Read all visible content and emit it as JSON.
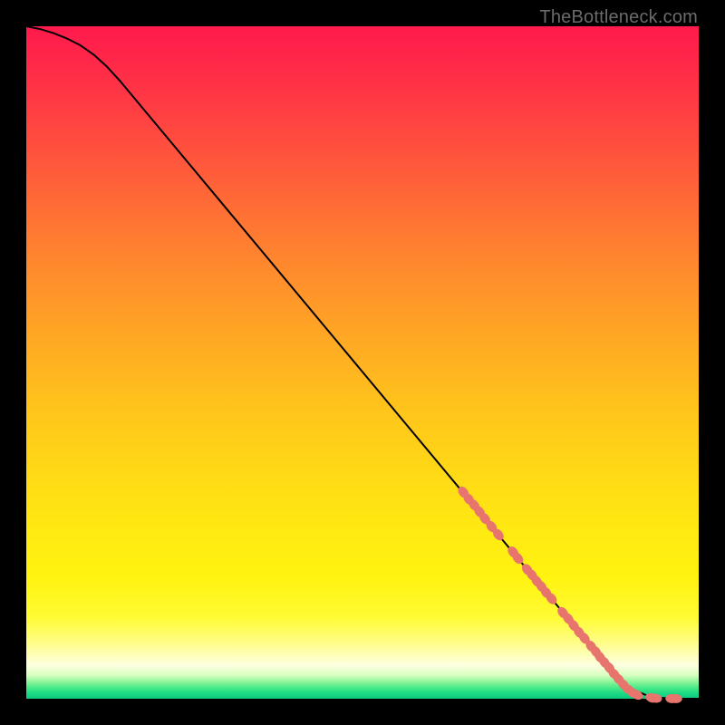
{
  "watermark": "TheBottleneck.com",
  "chart_data": {
    "type": "line",
    "title": "",
    "xlabel": "",
    "ylabel": "",
    "xlim": [
      0,
      100
    ],
    "ylim": [
      0,
      100
    ],
    "grid": false,
    "legend": false,
    "annotations": [],
    "series": [
      {
        "name": "bottleneck-curve",
        "x": [
          0,
          2,
          4,
          6,
          8,
          10,
          12,
          14,
          18,
          24,
          30,
          38,
          46,
          54,
          62,
          68,
          72,
          76,
          80,
          82,
          84,
          86,
          88,
          90,
          92,
          94,
          96,
          98,
          100
        ],
        "y": [
          100,
          99.6,
          99.0,
          98.2,
          97.2,
          95.8,
          94.0,
          91.8,
          87.0,
          79.8,
          72.6,
          63.0,
          53.4,
          43.8,
          34.2,
          27.0,
          22.2,
          17.4,
          12.6,
          10.2,
          7.8,
          5.4,
          3.0,
          1.5,
          0.6,
          0.15,
          0.05,
          0.0,
          0.0
        ]
      }
    ],
    "markers": {
      "name": "highlighted-points",
      "style": "thick-dot",
      "color": "#e8756d",
      "x": [
        65.0,
        65.8,
        66.6,
        67.4,
        68.2,
        69.2,
        70.2,
        72.4,
        73.1,
        74.5,
        75.2,
        75.9,
        76.6,
        77.3,
        78.1,
        79.8,
        80.6,
        81.4,
        82.2,
        83.0,
        84.0,
        84.7,
        85.3,
        86.0,
        86.7,
        87.4,
        88.1,
        88.8,
        89.5,
        90.2,
        90.8,
        93.0,
        93.6,
        96.0,
        96.6
      ],
      "y": [
        30.7,
        29.7,
        28.8,
        27.8,
        26.8,
        25.6,
        24.4,
        21.8,
        20.9,
        19.2,
        18.4,
        17.5,
        16.7,
        15.8,
        14.9,
        12.8,
        11.9,
        10.9,
        9.9,
        9.0,
        7.8,
        7.0,
        6.2,
        5.4,
        4.6,
        3.7,
        2.9,
        2.1,
        1.4,
        0.9,
        0.6,
        0.12,
        0.08,
        0.02,
        0.01
      ]
    }
  }
}
